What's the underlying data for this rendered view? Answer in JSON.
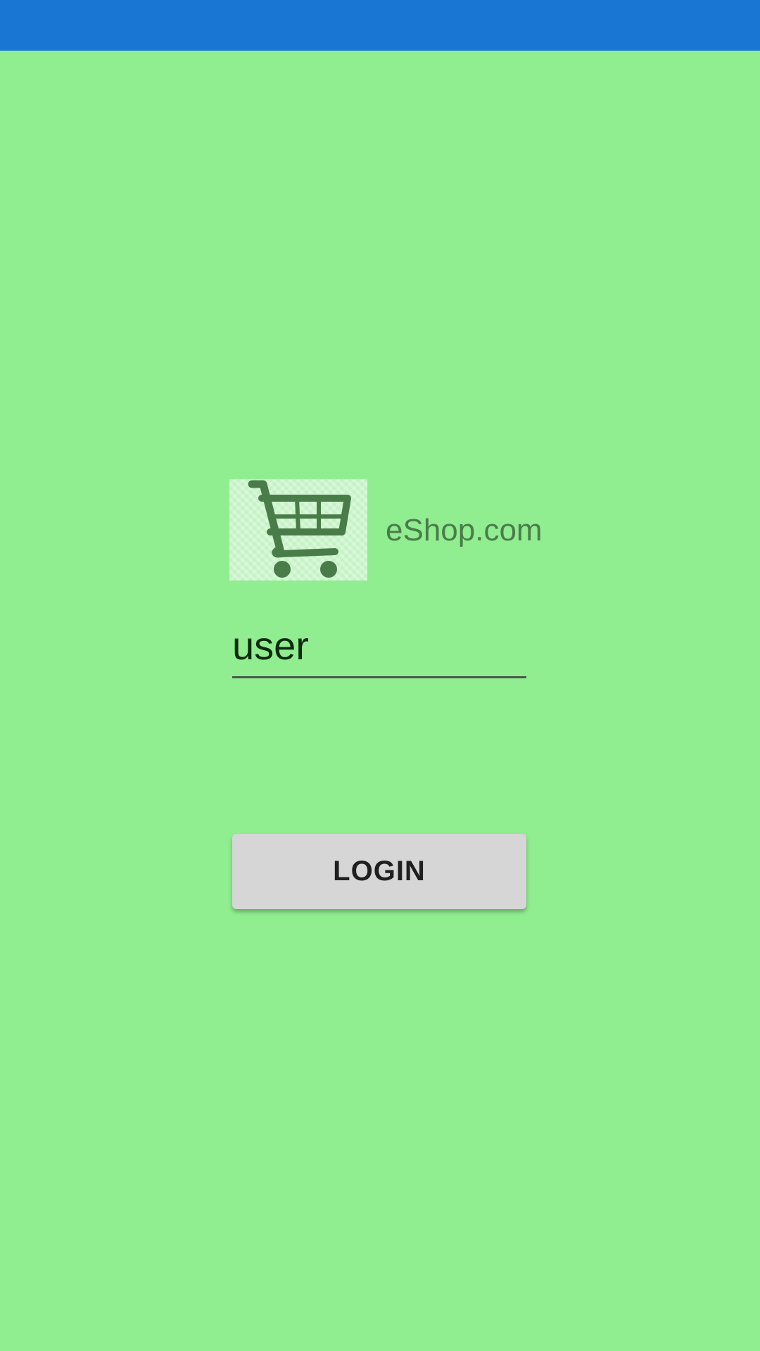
{
  "status_bar": {
    "color": "#1976D2"
  },
  "background_color": "#90EE90",
  "logo": {
    "icon": "shopping-cart-icon",
    "icon_color": "#4A7C4A"
  },
  "brand": {
    "name": "eShop.com"
  },
  "login_form": {
    "username_value": "user",
    "login_label": "LOGIN"
  }
}
